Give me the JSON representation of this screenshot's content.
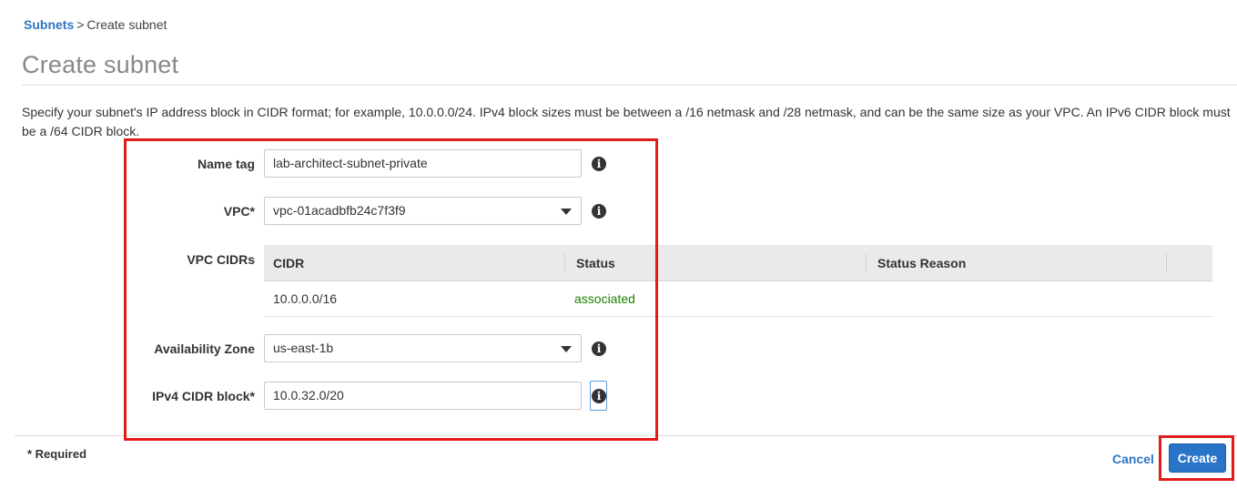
{
  "breadcrumb": {
    "parent": "Subnets",
    "separator": ">",
    "current": "Create subnet"
  },
  "page": {
    "title": "Create subnet",
    "intro": "Specify your subnet's IP address block in CIDR format; for example, 10.0.0.0/24. IPv4 block sizes must be between a /16 netmask and /28 netmask, and can be the same size as your VPC. An IPv6 CIDR block must be a /64 CIDR block."
  },
  "form": {
    "name_tag": {
      "label": "Name tag",
      "value": "lab-architect-subnet-private"
    },
    "vpc": {
      "label": "VPC*",
      "value": "vpc-01acadbfb24c7f3f9"
    },
    "vpc_cidrs": {
      "label": "VPC CIDRs",
      "columns": [
        "CIDR",
        "Status",
        "Status Reason"
      ],
      "rows": [
        {
          "cidr": "10.0.0.0/16",
          "status": "associated",
          "reason": ""
        }
      ]
    },
    "availability_zone": {
      "label": "Availability Zone",
      "value": "us-east-1b"
    },
    "ipv4_cidr": {
      "label": "IPv4 CIDR block*",
      "value": "10.0.32.0/20"
    }
  },
  "icons": {
    "info": "info-icon",
    "dropdown": "caret-down-icon"
  },
  "footer": {
    "required_note": "* Required",
    "cancel_label": "Cancel",
    "create_label": "Create"
  },
  "colors": {
    "link": "#2f76c2",
    "primary_button": "#2a74c8",
    "status_ok": "#1d8102",
    "highlight": "#e21b1b"
  }
}
